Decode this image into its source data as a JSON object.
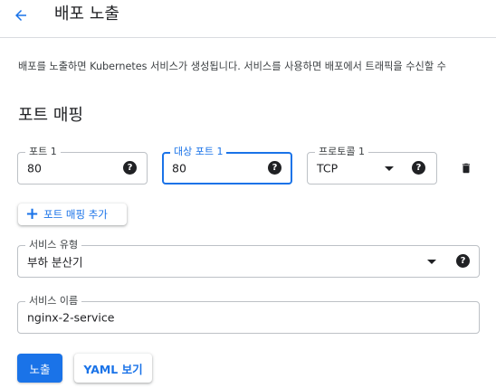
{
  "header": {
    "title": "배포 노출"
  },
  "description": "배포를 노출하면 Kubernetes 서비스가 생성됩니다. 서비스를 사용하면 배포에서 트래픽을 수신할 수",
  "port_mapping": {
    "section_title": "포트 매핑",
    "port": {
      "label": "포트 1",
      "value": "80"
    },
    "target_port": {
      "label": "대상 포트 1",
      "value": "80"
    },
    "protocol": {
      "label": "프로토콜 1",
      "value": "TCP"
    },
    "add_button_label": "포트 매핑 추가"
  },
  "service_type": {
    "label": "서비스 유형",
    "value": "부하 분산기"
  },
  "service_name": {
    "label": "서비스 이름",
    "value": "nginx-2-service"
  },
  "actions": {
    "expose_label": "노출",
    "yaml_label": "YAML 보기"
  },
  "colors": {
    "accent": "#1a73e8",
    "border": "#bdc1c6",
    "text": "#202124"
  }
}
